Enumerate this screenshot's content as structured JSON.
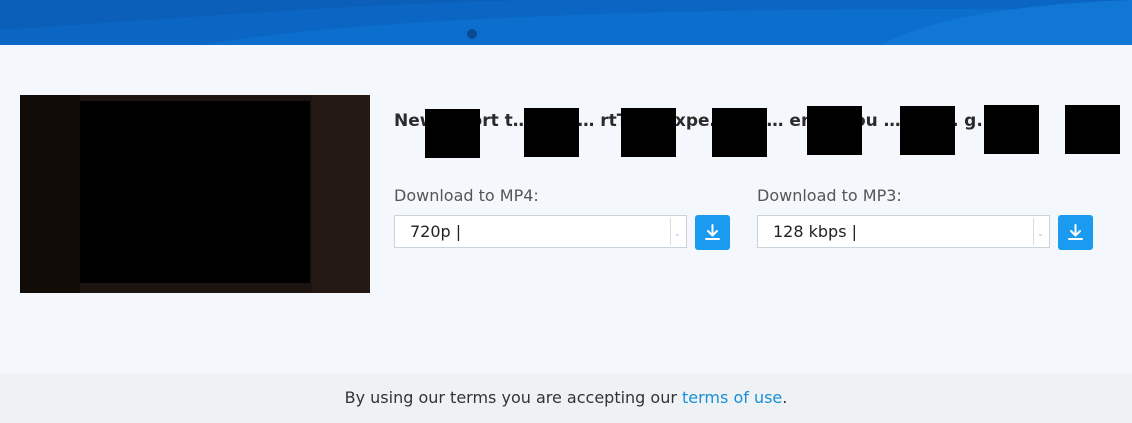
{
  "video": {
    "title": "New… port t… me. … rtTh… expe… Not… endi… ou … exp… g..."
  },
  "mp4": {
    "label": "Download to MP4:",
    "selected": "720p |",
    "button_icon": "download-icon"
  },
  "mp3": {
    "label": "Download to MP3:",
    "selected": "128 kbps |",
    "button_icon": "download-icon"
  },
  "footer": {
    "text_before": "By using our terms you are accepting our ",
    "link": "terms of use",
    "text_after": "."
  },
  "colors": {
    "header": "#0a66c2",
    "accent": "#1a9bf0",
    "link": "#1a8fd6"
  }
}
